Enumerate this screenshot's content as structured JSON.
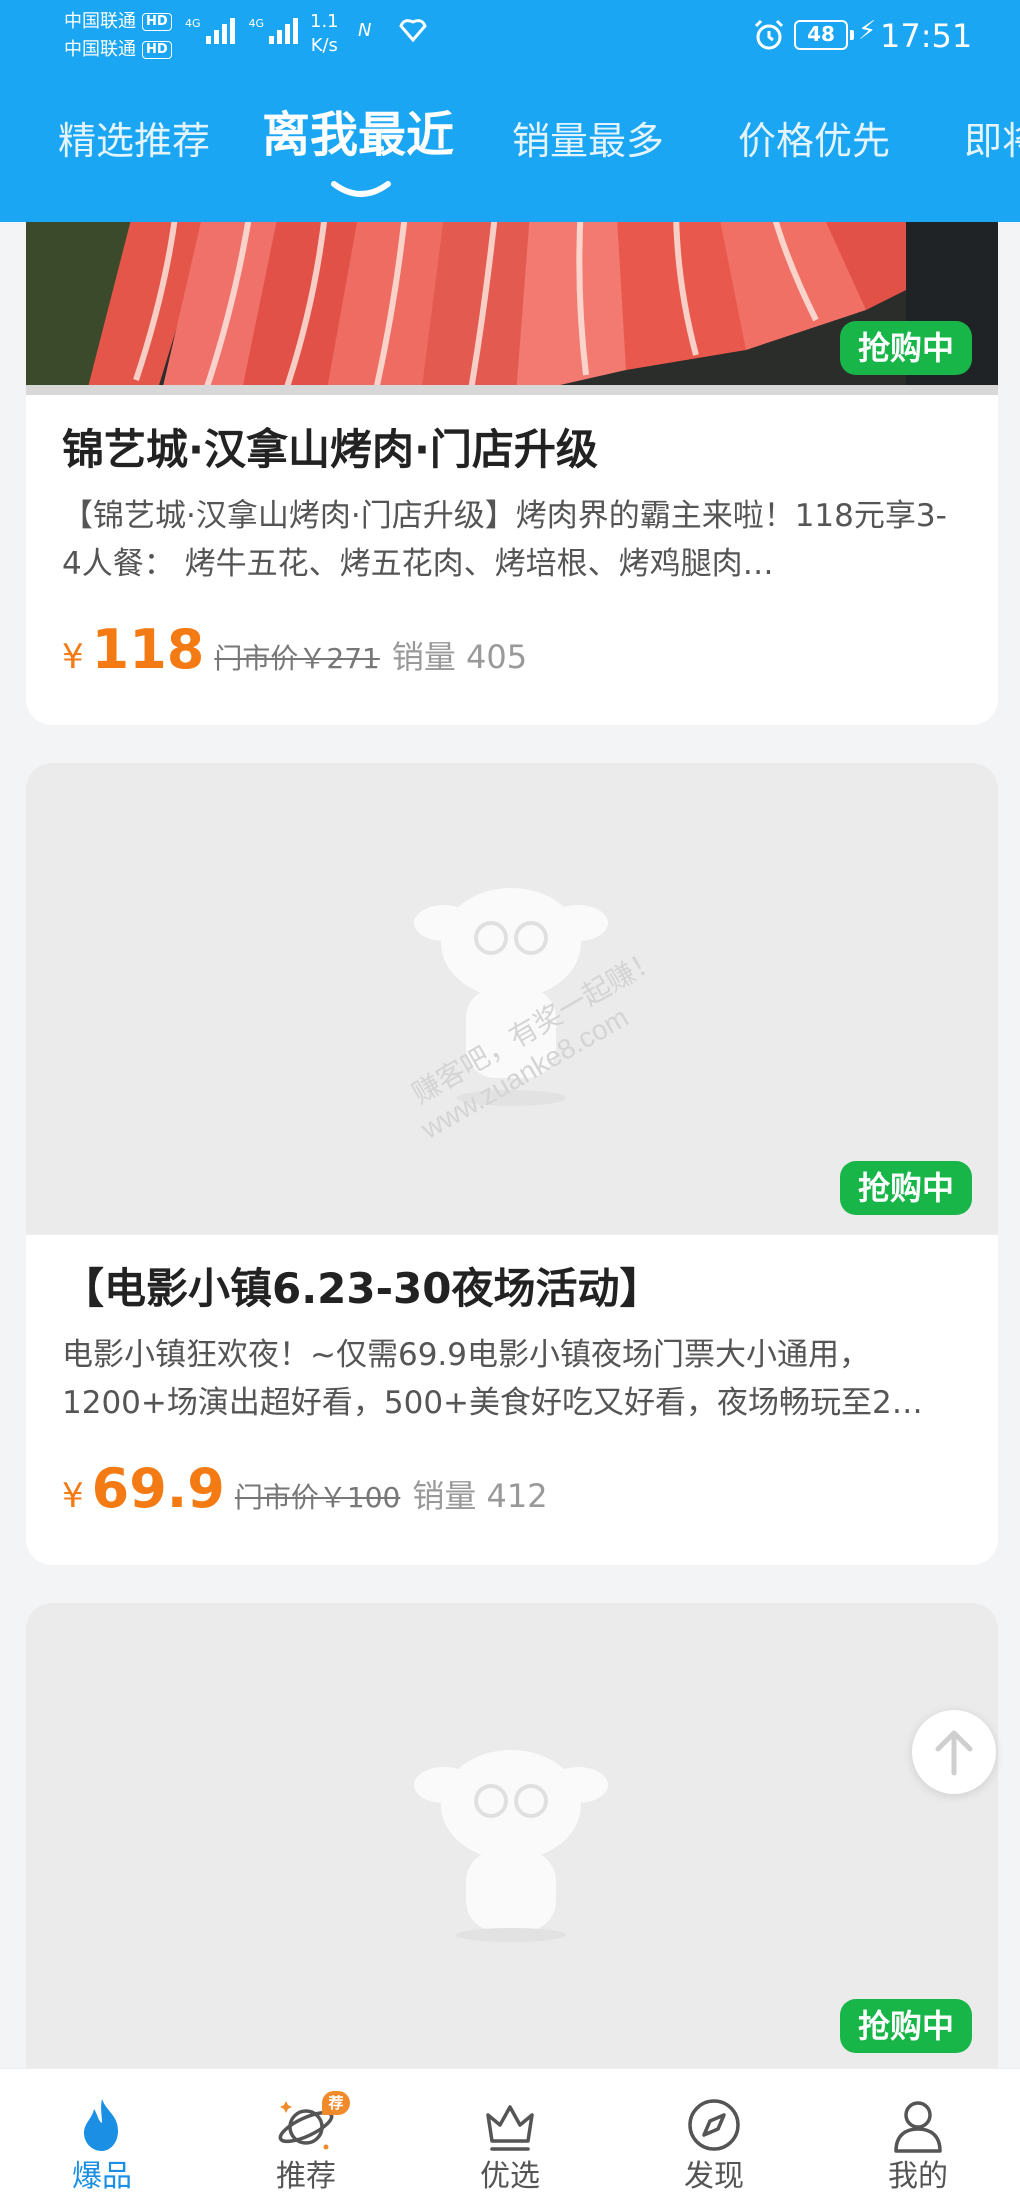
{
  "status_bar": {
    "carrier1": "中国联通",
    "carrier2": "中国联通",
    "hd_label": "HD",
    "network1": "4G",
    "network2": "4G",
    "speed_value": "1.1",
    "speed_unit": "K/s",
    "nfc": "N",
    "battery": "48",
    "time": "17:51"
  },
  "tabs": [
    {
      "label": "精选推荐",
      "active": false
    },
    {
      "label": "离我最近",
      "active": true
    },
    {
      "label": "销量最多",
      "active": false
    },
    {
      "label": "价格优先",
      "active": false
    },
    {
      "label": "即将",
      "active": false
    }
  ],
  "cards": [
    {
      "badge": "抢购中",
      "title": "锦艺城·汉拿山烤肉·门店升级",
      "desc": "【锦艺城·汉拿山烤肉·门店升级】烤肉界的霸主来啦！118元享3-4人餐： 烤牛五花、烤五花肉、烤培根、烤鸡腿肉…",
      "currency": "¥",
      "price": "118",
      "orig_price": "门市价￥271",
      "sales": "销量 405"
    },
    {
      "badge": "抢购中",
      "title": "【电影小镇6.23-30夜场活动】",
      "desc": "电影小镇狂欢夜！~仅需69.9电影小镇夜场门票大小通用，1200+场演出超好看，500+美食好吃又好看，夜场畅玩至2…",
      "currency": "¥",
      "price": "69.9",
      "orig_price": "门市价￥100",
      "sales": "销量 412",
      "watermark_line1": "赚客吧，有奖一起赚！",
      "watermark_line2": "www.zuanke8.com"
    },
    {
      "badge": "抢购中"
    }
  ],
  "bottom_nav": [
    {
      "label": "爆品",
      "icon": "flame-icon",
      "active": true
    },
    {
      "label": "推荐",
      "icon": "planet-icon",
      "active": false,
      "tag": "荐"
    },
    {
      "label": "优选",
      "icon": "crown-icon",
      "active": false
    },
    {
      "label": "发现",
      "icon": "compass-icon",
      "active": false
    },
    {
      "label": "我的",
      "icon": "user-icon",
      "active": false
    }
  ],
  "colors": {
    "header_blue": "#1aa6f2",
    "price_orange": "#f47a14",
    "badge_green": "#18b548",
    "nav_active_blue": "#1a8fe3"
  }
}
